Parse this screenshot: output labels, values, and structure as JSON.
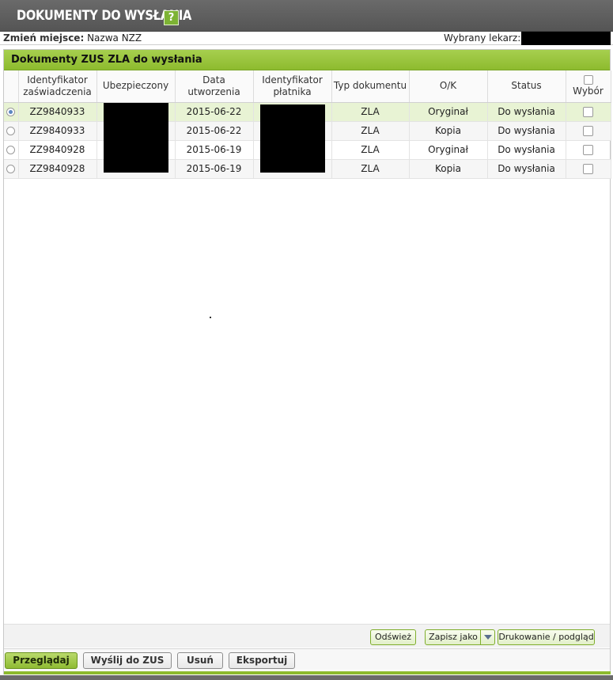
{
  "header": {
    "title": "DOKUMENTY DO WYSŁANIA",
    "help_label": "?"
  },
  "info": {
    "place_label": "Zmień miejsce:",
    "place_value": "Nazwa NZZ",
    "doctor_label": "Wybrany lekarz:"
  },
  "panel": {
    "title": "Dokumenty ZUS ZLA do wysłania"
  },
  "columns": [
    "Identyfikator zaświadczenia",
    "Ubezpieczony",
    "Data utworzenia",
    "Identyfikator płatnika",
    "Typ dokumentu",
    "O/K",
    "Status",
    "Wybór"
  ],
  "rows": [
    {
      "id": "ZZ9840933",
      "date": "2015-06-22",
      "type": "ZLA",
      "ok": "Oryginał",
      "status": "Do wysłania",
      "selected": true
    },
    {
      "id": "ZZ9840933",
      "date": "2015-06-22",
      "type": "ZLA",
      "ok": "Kopia",
      "status": "Do wysłania",
      "selected": false
    },
    {
      "id": "ZZ9840928",
      "date": "2015-06-19",
      "type": "ZLA",
      "ok": "Oryginał",
      "status": "Do wysłania",
      "selected": false
    },
    {
      "id": "ZZ9840928",
      "date": "2015-06-19",
      "type": "ZLA",
      "ok": "Kopia",
      "status": "Do wysłania",
      "selected": false
    }
  ],
  "toolbar": {
    "refresh": "Odśwież",
    "save_as": "Zapisz jako",
    "print": "Drukowanie / podgląd"
  },
  "actions": {
    "browse": "Przeglądaj",
    "send": "Wyślij do ZUS",
    "delete": "Usuń",
    "export": "Eksportuj"
  }
}
